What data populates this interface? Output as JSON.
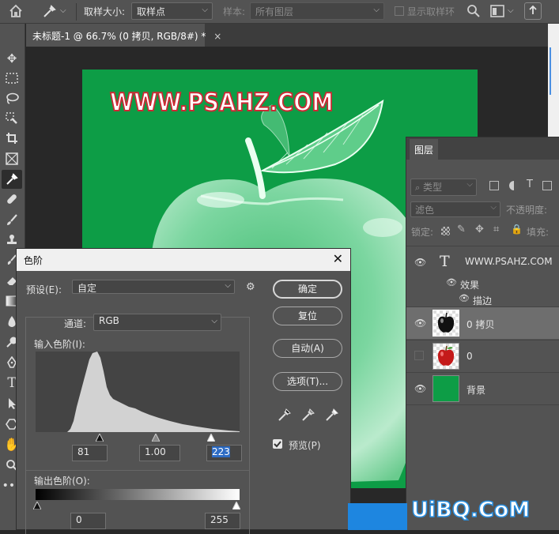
{
  "options_bar": {
    "sample_size_label": "取样大小:",
    "sample_size_value": "取样点",
    "sample_label": "样本:",
    "sample_value": "所有图层",
    "show_ring_label": "显示取样环"
  },
  "tab": {
    "title": "未标题-1 @ 66.7% (0 拷贝, RGB/8#) *",
    "close": "×"
  },
  "toolbar": {
    "tools": [
      "move-icon",
      "marquee-icon",
      "lasso-icon",
      "quick-select-icon",
      "crop-icon",
      "frame-icon",
      "eyedropper-icon",
      "healing-icon",
      "brush-icon",
      "stamp-icon",
      "history-brush-icon",
      "eraser-icon",
      "gradient-icon",
      "blur-icon",
      "dodge-icon",
      "pen-icon",
      "type-icon",
      "path-select-icon",
      "shape-icon",
      "hand-icon",
      "zoom-icon",
      "more-icon"
    ]
  },
  "canvas": {
    "watermark": "WWW.PSAHZ.COM",
    "bg_color": "#0d9d46"
  },
  "layers_panel": {
    "tab": "图层",
    "filter_type": "类型",
    "blend_mode": "滤色",
    "opacity_label": "不透明度:",
    "lock_label": "锁定:",
    "fill_label": "填充:",
    "layers": [
      {
        "name": "WWW.PSAHZ.COM",
        "kind": "text",
        "visible": true
      },
      {
        "name": "效果",
        "kind": "effects"
      },
      {
        "name": "描边",
        "kind": "effect"
      },
      {
        "name": "0 拷贝",
        "kind": "apple-bw",
        "visible": true,
        "selected": true
      },
      {
        "name": "0",
        "kind": "apple-color",
        "visible": false
      },
      {
        "name": "背景",
        "kind": "fill",
        "visible": true,
        "color": "#0d9d46"
      }
    ]
  },
  "levels_dialog": {
    "title": "色阶",
    "close": "✕",
    "preset_label": "预设(E):",
    "preset_value": "自定",
    "channel_label": "通道:",
    "channel_value": "RGB",
    "input_label": "输入色阶(I):",
    "input_black": "81",
    "input_gamma": "1.00",
    "input_white": "223",
    "output_label": "输出色阶(O):",
    "output_black": "0",
    "output_white": "255",
    "buttons": {
      "ok": "确定",
      "reset": "复位",
      "auto": "自动(A)",
      "options": "选项(T)..."
    },
    "preview_label": "预览(P)",
    "preview_checked": true
  },
  "site_watermark": "UiBQ.CoM"
}
